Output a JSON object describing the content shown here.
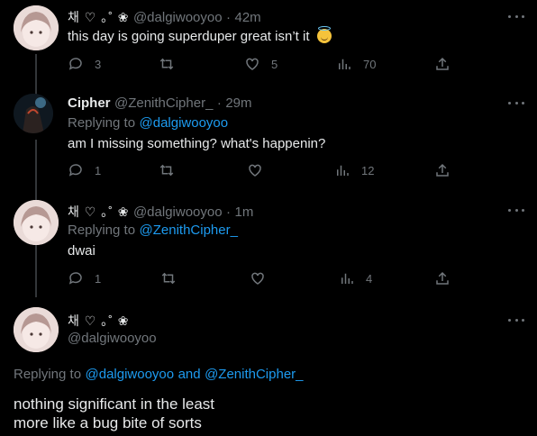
{
  "tweets": [
    {
      "display_name": "채 ♡ ｡˚ ❀",
      "handle": "@dalgiwooyoo",
      "time": "42m",
      "text": "this day is going superduper great isn’t it",
      "emoji_icon": "smiling-face-with-halo",
      "replies": "3",
      "retweets": "",
      "likes": "5",
      "views": "70"
    },
    {
      "display_name": "Cipher",
      "handle": "@ZenithCipher_",
      "time": "29m",
      "replying_to_label": "Replying to",
      "replying_to": "@dalgiwooyoo",
      "text": "am I missing something? what's happenin?",
      "replies": "1",
      "retweets": "",
      "likes": "",
      "views": "12"
    },
    {
      "display_name": "채 ♡ ｡˚ ❀",
      "handle": "@dalgiwooyoo",
      "time": "1m",
      "replying_to_label": "Replying to",
      "replying_to": "@ZenithCipher_",
      "text": "dwai",
      "replies": "1",
      "retweets": "",
      "likes": "",
      "views": "4"
    }
  ],
  "focused": {
    "display_name": "채 ♡ ｡˚ ❀",
    "handle": "@dalgiwooyoo",
    "replying_to_label": "Replying to",
    "replying_to_1": "@dalgiwooyoo",
    "and_label": "and",
    "replying_to_2": "@ZenithCipher_",
    "text_line_1": "nothing significant in the least",
    "text_line_2": "more like a bug bite of sorts"
  },
  "separator": "·",
  "colors": {
    "background": "#000000",
    "text": "#e7e9ea",
    "muted": "#71767b",
    "link": "#1d9bf0",
    "thread_line": "#333639"
  }
}
